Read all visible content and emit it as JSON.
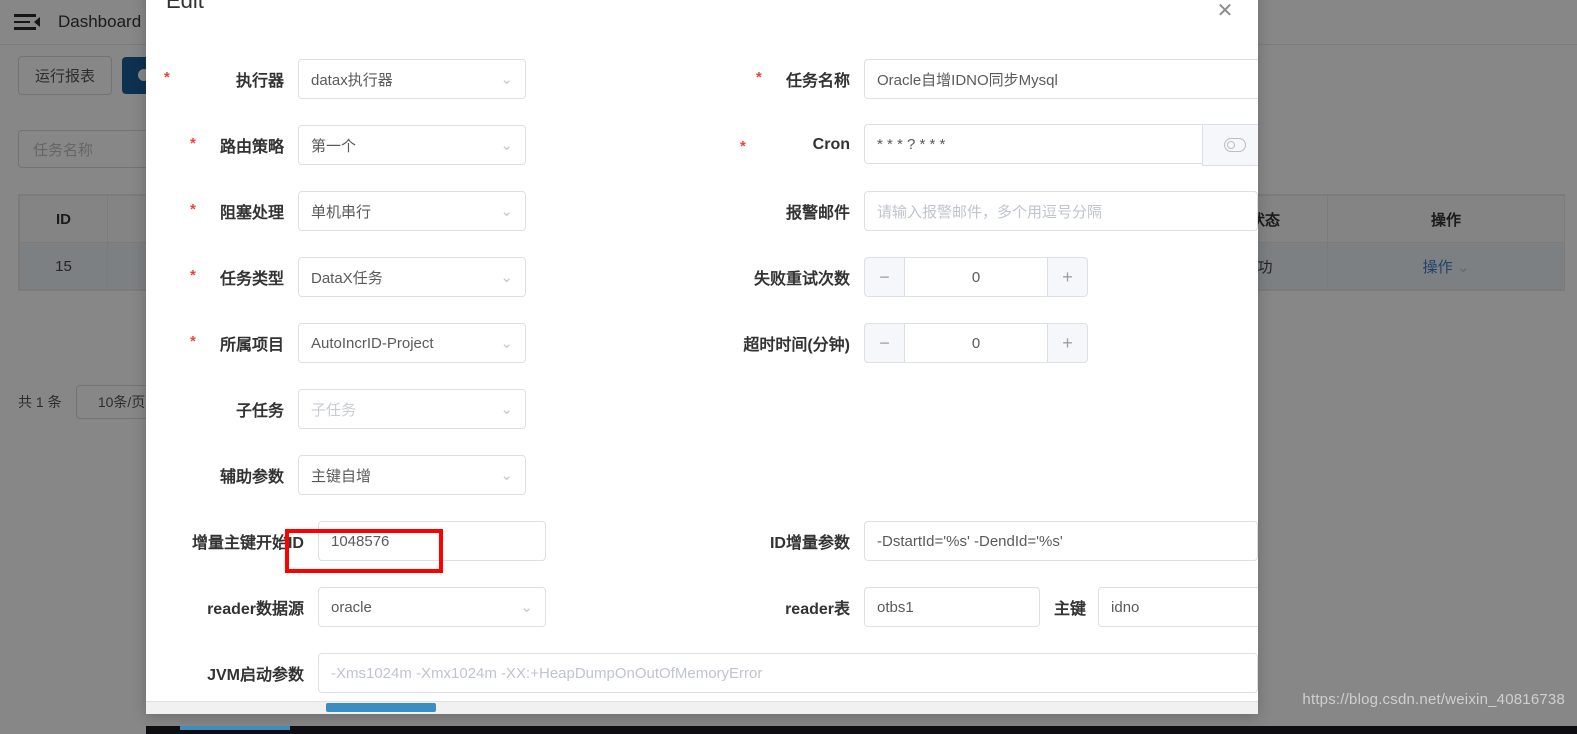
{
  "background": {
    "topbar": {
      "menu_icon": "hamburger-collapse-icon",
      "breadcrumb": "Dashboard"
    },
    "toolbar": {
      "report_button": "运行报表",
      "primary_button": ""
    },
    "search": {
      "placeholder": "任务名称"
    },
    "table": {
      "headers": [
        "ID",
        "",
        "",
        "",
        "",
        "行状态",
        "操作"
      ],
      "rows": [
        {
          "id": "15",
          "c2": "",
          "c3": "",
          "c4": "",
          "c5": "",
          "status": "成功",
          "action": "操作"
        }
      ]
    },
    "pager": {
      "total": "共 1 条",
      "page_size": "10条/页"
    }
  },
  "modal": {
    "title": "Edit",
    "close_icon": "close-icon",
    "fields": {
      "executor": {
        "label": "执行器",
        "value": "datax执行器",
        "required": true
      },
      "route_strategy": {
        "label": "路由策略",
        "value": "第一个",
        "required": true
      },
      "block_strategy": {
        "label": "阻塞处理",
        "value": "单机串行",
        "required": true
      },
      "task_type": {
        "label": "任务类型",
        "value": "DataX任务",
        "required": true
      },
      "project": {
        "label": "所属项目",
        "value": "AutoIncrID-Project",
        "required": true
      },
      "sub_task": {
        "label": "子任务",
        "placeholder": "子任务",
        "required": false
      },
      "aux_param": {
        "label": "辅助参数",
        "value": "主键自增",
        "required": false
      },
      "incr_start_id": {
        "label": "增量主键开始ID",
        "value": "1048576",
        "required": false
      },
      "reader_datasource": {
        "label": "reader数据源",
        "value": "oracle",
        "required": false
      },
      "jvm_args": {
        "label": "JVM启动参数",
        "placeholder": "-Xms1024m -Xmx1024m -XX:+HeapDumpOnOutOfMemoryError",
        "required": false
      },
      "task_name": {
        "label": "任务名称",
        "value": "Oracle自增IDNO同步Mysql",
        "required": true,
        "suffix_icon": "clipboard-icon"
      },
      "cron": {
        "label": "Cron",
        "value": "* * * ? * * *",
        "required": true,
        "button_icon": "eye-toggle-icon"
      },
      "alarm_email": {
        "label": "报警邮件",
        "placeholder": "请输入报警邮件，多个用逗号分隔",
        "required": false
      },
      "retry_count": {
        "label": "失败重试次数",
        "value": "0",
        "minus": "−",
        "plus": "+"
      },
      "timeout_minutes": {
        "label": "超时时间(分钟)",
        "value": "0",
        "minus": "−",
        "plus": "+"
      },
      "id_incr_param": {
        "label": "ID增量参数",
        "value": "-DstartId='%s' -DendId='%s'"
      },
      "reader_table": {
        "label": "reader表",
        "value": "otbs1"
      },
      "primary_key": {
        "label": "主键",
        "value": "idno"
      }
    }
  },
  "annotation": {
    "highlight_color": "#ff0000",
    "target": "增量主键开始ID"
  },
  "watermark": {
    "text": "https://blog.csdn.net/weixin_40816738"
  }
}
